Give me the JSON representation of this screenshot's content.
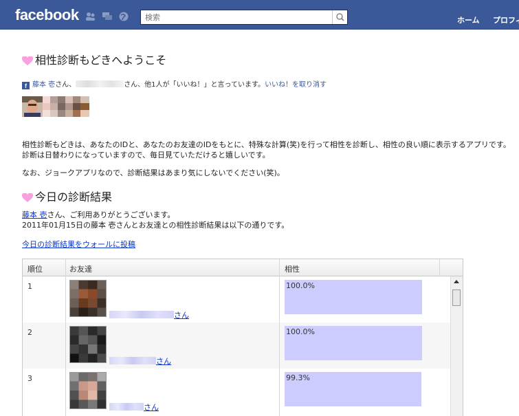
{
  "header": {
    "logo": "facebook",
    "search_placeholder": "検索",
    "nav": [
      "ホーム",
      "プロフィ"
    ]
  },
  "intro": {
    "title": "相性診断もどきへようこそ",
    "like_name": "藤本 壱",
    "like_mid": "さん、",
    "like_mid2": "さん、他1人が「いいね！」と言っています。",
    "like_undo": "いいね！を取り消す",
    "desc_line1": "相性診断もどきは、あなたのIDと、あなたのお友達のIDをもとに、特殊な計算(笑)を行って相性を診断し、相性の良い順に表示するアプリです。",
    "desc_line2": "診断は日替わりになっていますので、毎日見ていただけると嬉しいです。",
    "desc_line3": "なお、ジョークアプリなので、診断結果はあまり気にしないでください(笑)。"
  },
  "results": {
    "title": "今日の診断結果",
    "user_link": "藤本 壱",
    "thanks": "さん、ご利用ありがとうございます。",
    "date_line": "2011年01月15日の藤本 壱さんとお友達との相性診断結果は以下の通りです。",
    "post_link": "今日の診断結果をウォールに投稿",
    "table": {
      "headers": [
        "順位",
        "お友達",
        "相性"
      ],
      "rows": [
        {
          "rank": "1",
          "suffix": "さん",
          "value": 100.0,
          "label": "100.0%"
        },
        {
          "rank": "2",
          "suffix": "さん",
          "value": 100.0,
          "label": "100.0%"
        },
        {
          "rank": "3",
          "suffix": "さん",
          "value": 99.3,
          "label": "99.3%"
        }
      ]
    }
  },
  "colors": {
    "brand": "#3b5998",
    "bar": "#ccccff",
    "link": "#0b36c8"
  }
}
